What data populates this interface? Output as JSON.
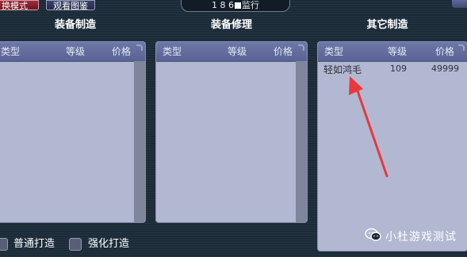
{
  "top_bar": {
    "mode_tab": "换模式",
    "view_tab": "观看图鉴",
    "center_text": "1 8 6",
    "center_text2": "监行"
  },
  "columns": [
    {
      "title": "装备制造",
      "headers": [
        "类型",
        "等级",
        "价格"
      ],
      "rows": []
    },
    {
      "title": "装备修理",
      "headers": [
        "类型",
        "等级",
        "价格"
      ],
      "rows": []
    },
    {
      "title": "其它制造",
      "headers": [
        "类型",
        "等级",
        "价格"
      ],
      "rows": [
        {
          "name": "轻如鸿毛",
          "level": "109",
          "price": "49999"
        }
      ]
    }
  ],
  "options": {
    "normal_craft": "普通打造",
    "enhanced_craft": "强化打造"
  },
  "watermark": {
    "text": "小杜游戏测试",
    "icon": "wechat-icon"
  },
  "annotation": {
    "icon": "red-arrow-icon",
    "color": "#e8383d"
  }
}
